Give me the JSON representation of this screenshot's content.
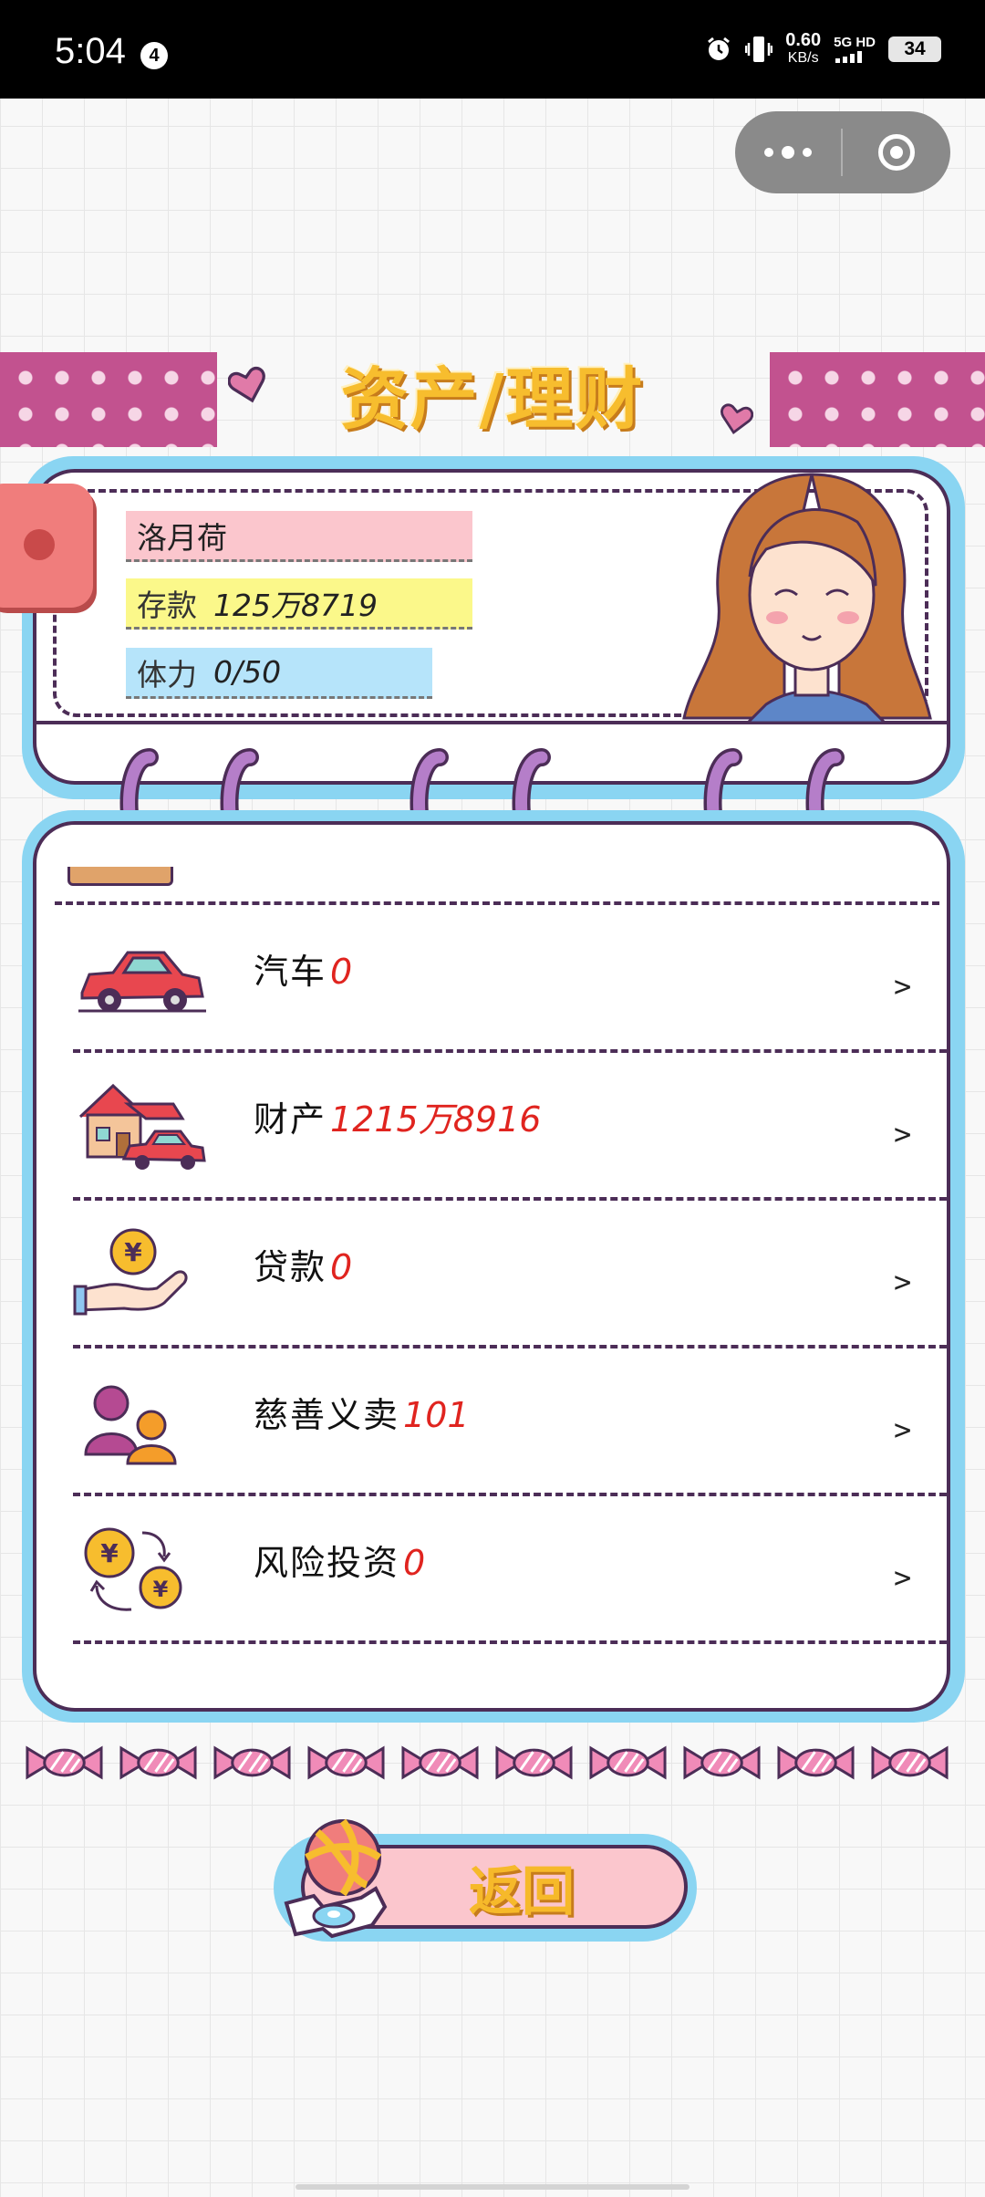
{
  "status_bar": {
    "time": "5:04",
    "notification_count": "4",
    "net_speed": "0.60",
    "net_unit": "KB/s",
    "signal_label": "5G HD",
    "battery": "34"
  },
  "page": {
    "title": "资产/理财"
  },
  "profile": {
    "name": "洛月荷",
    "savings_label": "存款",
    "savings_value": "125万8719",
    "stamina_label": "体力",
    "stamina_value": "0/50"
  },
  "list": {
    "items": [
      {
        "label": "汽车",
        "value": "0",
        "icon": "car-icon",
        "arrow": ">"
      },
      {
        "label": "财产",
        "value": "1215万8916",
        "icon": "house-icon",
        "arrow": ">"
      },
      {
        "label": "贷款",
        "value": "0",
        "icon": "loan-coin-hand-icon",
        "arrow": ">"
      },
      {
        "label": "慈善义卖",
        "value": "101",
        "icon": "charity-people-icon",
        "arrow": ">"
      },
      {
        "label": "风险投资",
        "value": "0",
        "icon": "investment-coins-icon",
        "arrow": ">"
      }
    ]
  },
  "back_button": {
    "label": "返回"
  },
  "colors": {
    "accent_purple": "#4c2d57",
    "frame_blue": "#8ad5f2",
    "title_yellow": "#f7bd2e",
    "value_red": "#e0241f",
    "tape_pink": "#c2528f"
  }
}
